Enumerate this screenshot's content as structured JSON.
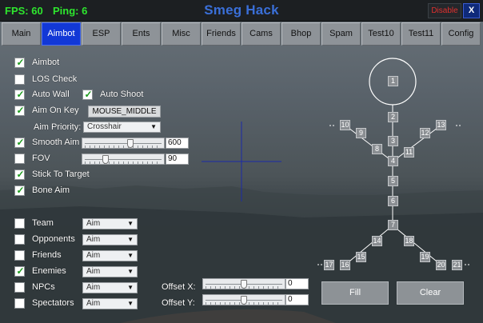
{
  "header": {
    "fps": "FPS: 60",
    "ping": "Ping: 6",
    "title": "Smeg Hack",
    "disable_label": "Disable",
    "close_label": "X"
  },
  "tabs": [
    {
      "label": "Main",
      "active": false
    },
    {
      "label": "Aimbot",
      "active": true
    },
    {
      "label": "ESP",
      "active": false
    },
    {
      "label": "Ents",
      "active": false
    },
    {
      "label": "Misc",
      "active": false
    },
    {
      "label": "Friends",
      "active": false
    },
    {
      "label": "Cams",
      "active": false
    },
    {
      "label": "Bhop",
      "active": false
    },
    {
      "label": "Spam",
      "active": false
    },
    {
      "label": "Test10",
      "active": false
    },
    {
      "label": "Test11",
      "active": false
    },
    {
      "label": "Config",
      "active": false
    }
  ],
  "aimbot": {
    "aimbot": {
      "label": "Aimbot",
      "checked": true
    },
    "los_check": {
      "label": "LOS Check",
      "checked": false
    },
    "auto_wall": {
      "label": "Auto Wall",
      "checked": true
    },
    "auto_shoot": {
      "label": "Auto Shoot",
      "checked": true
    },
    "aim_on_key": {
      "label": "Aim On Key",
      "checked": true,
      "key": "MOUSE_MIDDLE"
    },
    "aim_priority": {
      "label": "Aim Priority:",
      "value": "Crosshair"
    },
    "smooth_aim": {
      "label": "Smooth Aim",
      "checked": true,
      "value": "600",
      "level": 0.6
    },
    "fov": {
      "label": "FOV",
      "checked": false,
      "value": "90",
      "level": 0.25
    },
    "stick_to_target": {
      "label": "Stick To Target",
      "checked": true
    },
    "bone_aim": {
      "label": "Bone Aim",
      "checked": true
    }
  },
  "targets": [
    {
      "label": "Team",
      "checked": false,
      "mode": "Aim"
    },
    {
      "label": "Opponents",
      "checked": false,
      "mode": "Aim"
    },
    {
      "label": "Friends",
      "checked": false,
      "mode": "Aim"
    },
    {
      "label": "Enemies",
      "checked": true,
      "mode": "Aim"
    },
    {
      "label": "NPCs",
      "checked": false,
      "mode": "Aim"
    },
    {
      "label": "Spectators",
      "checked": false,
      "mode": "Aim"
    }
  ],
  "offsets": {
    "x": {
      "label": "Offset X:",
      "value": "0",
      "level": 0.5
    },
    "y": {
      "label": "Offset Y:",
      "value": "0",
      "level": 0.5
    }
  },
  "bones": {
    "labels": [
      "1",
      "2",
      "3",
      "4",
      "5",
      "6",
      "7",
      "8",
      "9",
      "10",
      "11",
      "12",
      "13",
      "14",
      "15",
      "16",
      "17",
      "18",
      "19",
      "20",
      "21"
    ],
    "fill_label": "Fill",
    "clear_label": "Clear"
  }
}
